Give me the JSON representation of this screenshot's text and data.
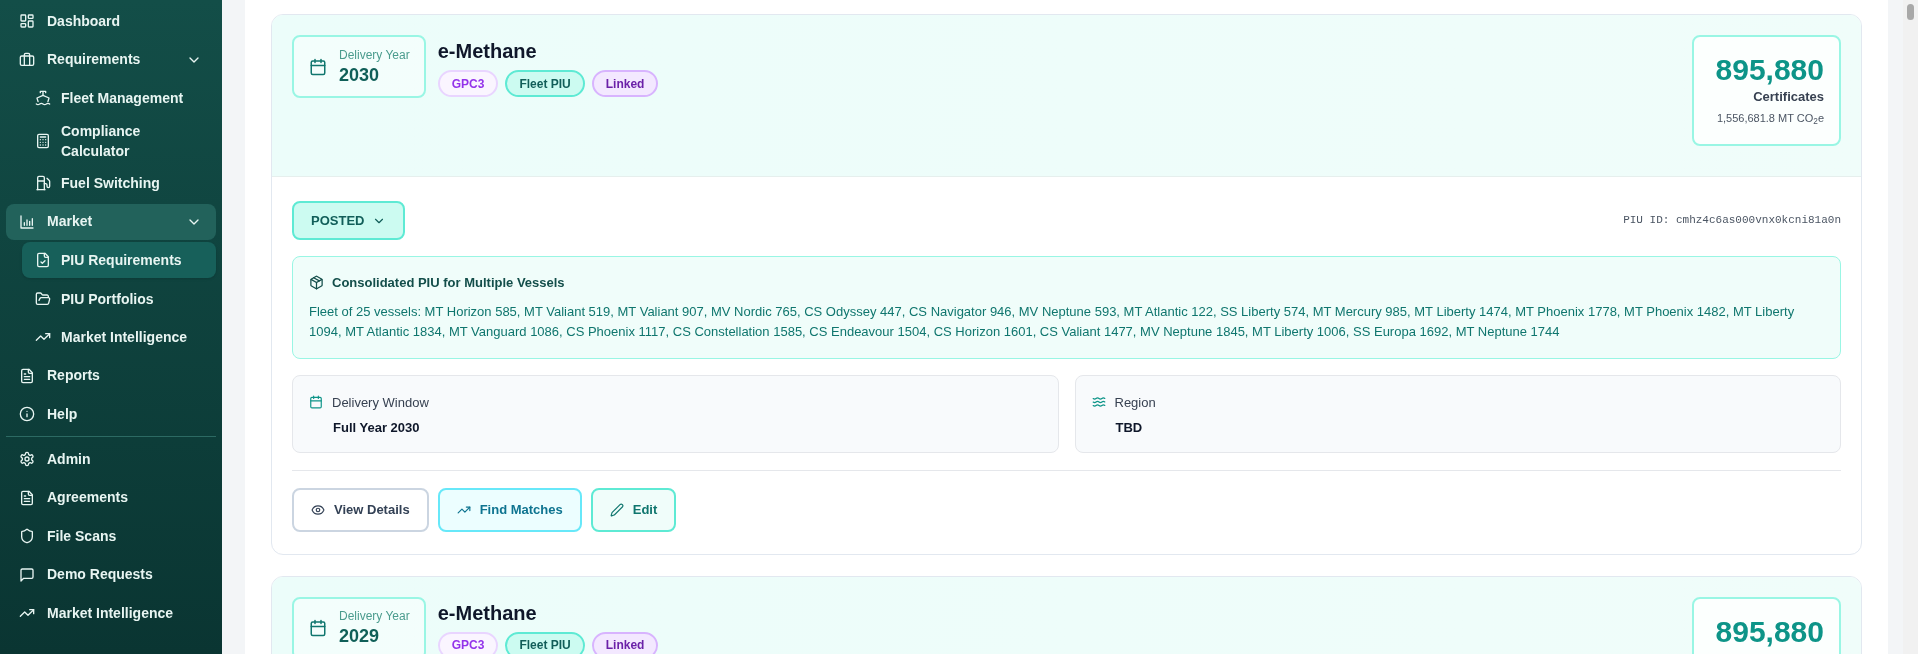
{
  "sidebar": {
    "sections": [
      {
        "items": [
          {
            "label": "Dashboard",
            "selected": false
          },
          {
            "label": "Requirements",
            "selected": false,
            "expanded": true,
            "children": [
              {
                "label": "Fleet Management",
                "selected": false
              },
              {
                "label": "Compliance Calculator",
                "selected": false
              },
              {
                "label": "Fuel Switching",
                "selected": false
              }
            ]
          },
          {
            "label": "Market",
            "selected": true,
            "expanded": true,
            "children": [
              {
                "label": "PIU Requirements",
                "selected": true
              },
              {
                "label": "PIU Portfolios",
                "selected": false
              },
              {
                "label": "Market Intelligence",
                "selected": false
              }
            ]
          },
          {
            "label": "Reports",
            "selected": false
          },
          {
            "label": "Help",
            "selected": false
          }
        ]
      },
      {
        "items": [
          {
            "label": "Admin",
            "selected": false
          },
          {
            "label": "Agreements",
            "selected": false
          },
          {
            "label": "File Scans",
            "selected": false
          },
          {
            "label": "Demo Requests",
            "selected": false
          },
          {
            "label": "Market Intelligence",
            "selected": false
          }
        ]
      }
    ]
  },
  "cards": [
    {
      "delivery_year_label": "Delivery Year",
      "delivery_year": "2030",
      "fuel": "e-Methane",
      "tags": [
        {
          "label": "GPC3",
          "kind": "standard"
        },
        {
          "label": "Fleet PIU",
          "kind": "fleet"
        },
        {
          "label": "Linked",
          "kind": "linked"
        }
      ],
      "certificates": {
        "value": "895,880",
        "label": "Certificates",
        "emissions": "1,556,681.8 MT CO$_{2}$e"
      },
      "status": "POSTED",
      "piu_id": "PIU ID: cmhz4c6as000vnx0kcni81a0n",
      "consolidated": {
        "title": "Consolidated PIU for Multiple Vessels",
        "vessels": "Fleet of 25 vessels: MT Horizon 585, MT Valiant 519, MT Valiant 907, MV Nordic 765, CS Odyssey 447, CS Navigator 946, MV Neptune 593, MT Atlantic 122, SS Liberty 574, MT Mercury 985, MT Liberty 1474, MT Phoenix 1778, MT Phoenix 1482, MT Liberty 1094, MT Atlantic 1834, MT Vanguard 1086, CS Phoenix 1117, CS Constellation 1585, CS Endeavour 1504, CS Horizon 1601, CS Valiant 1477, MV Neptune 1845, MT Liberty 1006, SS Europa 1692, MT Neptune 1744"
      },
      "details": [
        {
          "kind": "window",
          "label": "Delivery Window",
          "value": "Full Year 2030"
        },
        {
          "kind": "region",
          "label": "Region",
          "value": "TBD"
        }
      ],
      "actions": [
        {
          "kind": "details",
          "label": "View Details"
        },
        {
          "kind": "matches",
          "label": "Find Matches"
        },
        {
          "kind": "edit",
          "label": "Edit"
        }
      ]
    },
    {
      "delivery_year_label": "Delivery Year",
      "delivery_year": "2029",
      "fuel": "e-Methane",
      "tags": [
        {
          "label": "GPC3",
          "kind": "standard"
        },
        {
          "label": "Fleet PIU",
          "kind": "fleet"
        },
        {
          "label": "Linked",
          "kind": "linked"
        }
      ],
      "certificates": {
        "value": "895,880"
      }
    }
  ]
}
